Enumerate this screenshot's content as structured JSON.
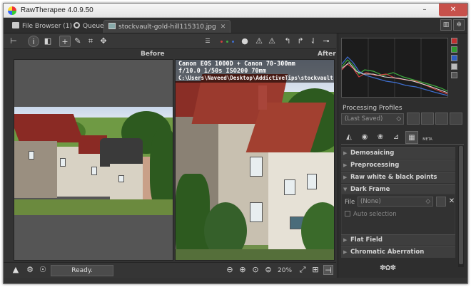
{
  "window": {
    "title": "RawTherapee 4.0.9.50",
    "controls": {
      "minimize": "–",
      "maximize": "□",
      "close": "✕"
    }
  },
  "tabs": [
    {
      "label": "File Browser  (1)",
      "icon": "folder-icon"
    },
    {
      "label": "Queue",
      "icon": "gear-icon"
    },
    {
      "label": "stockvault-gold-hill115310.jpg",
      "icon": "image-icon",
      "close": "✕"
    }
  ],
  "toolbar": {
    "icons": [
      "hand-tool-icon",
      "info-icon",
      "before-after-icon",
      "crosshair-icon",
      "color-picker-icon",
      "crop-icon",
      "straighten-icon",
      "clip-highlight-icon",
      "clip-shadow-icon",
      "rotate-left-icon",
      "rotate-right-icon",
      "flip-horizontal-icon",
      "flip-vertical-icon"
    ],
    "channel_colors": [
      "#d04040",
      "#3fae3f",
      "#3f6fd0",
      "#aaaaaa"
    ]
  },
  "viewers": {
    "before_label": "Before",
    "after_label": "After",
    "info_line1": "Canon EOS 1000D + Canon 70-300mm",
    "info_line2": "f/10.0  1/50s  ISO200  70mm",
    "info_line3": "C:\\Users\\Naveed\\Desktop\\AddictiveTips\\stockvault-gold-hill"
  },
  "bottom": {
    "status": "Ready.",
    "zoom_level": "20%"
  },
  "profiles": {
    "title": "Processing Profiles",
    "selected": "(Last Saved)"
  },
  "tool_tabs": [
    "exposure-tab",
    "detail-tab",
    "color-tab",
    "transform-tab",
    "raw-tab",
    "metadata-tab"
  ],
  "meta_tab_label": "META",
  "sections": {
    "demosaicing": "Demosaicing",
    "preprocessing": "Preprocessing",
    "raw_points": "Raw white & black points",
    "dark_frame": "Dark Frame",
    "flat_field": "Flat Field",
    "chromatic": "Chromatic Aberration"
  },
  "dark_frame": {
    "file_label": "File",
    "file_value": "(None)",
    "auto_selection": "Auto selection"
  }
}
